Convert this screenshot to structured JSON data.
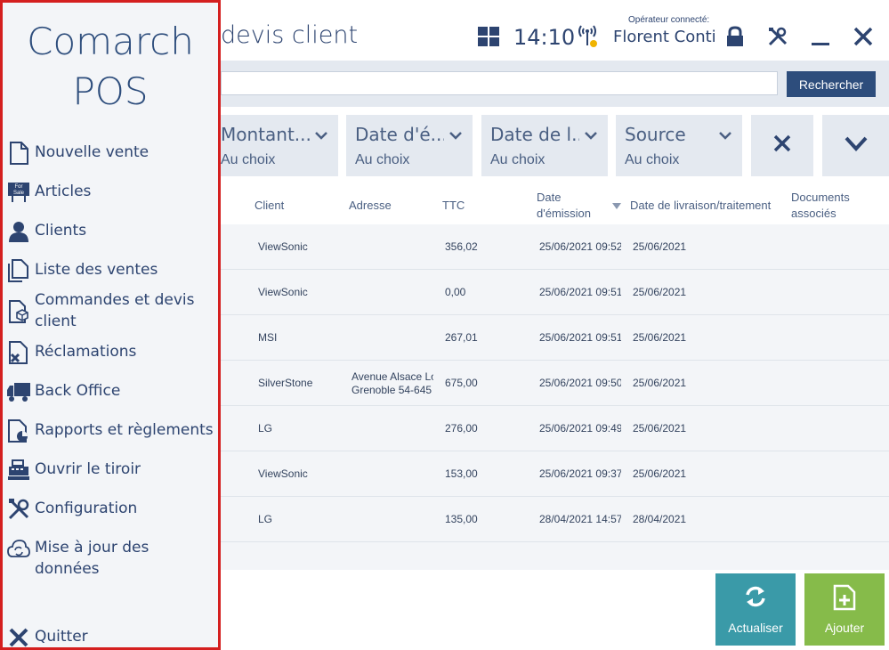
{
  "header": {
    "title": "devis client",
    "time": "14:10",
    "operator_label": "Opérateur connecté:",
    "operator_name": "Florent Conti"
  },
  "search": {
    "value": "",
    "placeholder": "",
    "button_label": "Rechercher"
  },
  "filters": [
    {
      "label": "Montant...",
      "value": "Au choix"
    },
    {
      "label": "Date d'é...",
      "value": "Au choix"
    },
    {
      "label": "Date de l...",
      "value": "Au choix"
    },
    {
      "label": "Source",
      "value": "Au choix"
    }
  ],
  "table": {
    "columns": {
      "client": "Client",
      "adresse": "Adresse",
      "ttc": "TTC",
      "date_emission_1": "Date",
      "date_emission_2": "d'émission",
      "date_livraison": "Date de livraison/traitement",
      "documents_1": "Documents",
      "documents_2": "associés"
    },
    "rows": [
      {
        "client": "ViewSonic",
        "adresse_1": "",
        "adresse_2": "",
        "ttc": "356,02",
        "date_emission": "25/06/2021 09:52",
        "date_livraison": "25/06/2021"
      },
      {
        "client": "ViewSonic",
        "adresse_1": "",
        "adresse_2": "",
        "ttc": "0,00",
        "date_emission": "25/06/2021 09:51",
        "date_livraison": "25/06/2021"
      },
      {
        "client": "MSI",
        "adresse_1": "",
        "adresse_2": "",
        "ttc": "267,01",
        "date_emission": "25/06/2021 09:51",
        "date_livraison": "25/06/2021"
      },
      {
        "client": "SilverStone",
        "adresse_1": "Avenue Alsace Lo",
        "adresse_2": "Grenoble 54-645",
        "ttc": "675,00",
        "date_emission": "25/06/2021 09:50",
        "date_livraison": "25/06/2021"
      },
      {
        "client": "LG",
        "adresse_1": "",
        "adresse_2": "",
        "ttc": "276,00",
        "date_emission": "25/06/2021 09:49",
        "date_livraison": "25/06/2021"
      },
      {
        "client": "ViewSonic",
        "adresse_1": "",
        "adresse_2": "",
        "ttc": "153,00",
        "date_emission": "25/06/2021 09:37",
        "date_livraison": "25/06/2021"
      },
      {
        "client": "LG",
        "adresse_1": "",
        "adresse_2": "",
        "ttc": "135,00",
        "date_emission": "28/04/2021 14:57",
        "date_livraison": "28/04/2021"
      }
    ]
  },
  "actions": {
    "refresh_label": "Actualiser",
    "add_label": "Ajouter"
  },
  "sidebar": {
    "brand_line1": "Comarch",
    "brand_line2": "POS",
    "items": [
      {
        "label": "Nouvelle vente",
        "icon": "document-icon"
      },
      {
        "label": "Articles",
        "icon": "for-sale-icon"
      },
      {
        "label": "Clients",
        "icon": "user-icon"
      },
      {
        "label": "Liste des ventes",
        "icon": "documents-icon"
      },
      {
        "label": "Commandes et devis client",
        "icon": "order-box-icon"
      },
      {
        "label": "Réclamations",
        "icon": "complaint-icon"
      },
      {
        "label": "Back Office",
        "icon": "truck-icon"
      },
      {
        "label": "Rapports et règlements",
        "icon": "report-icon"
      },
      {
        "label": "Ouvrir le tiroir",
        "icon": "cash-register-icon"
      },
      {
        "label": "Configuration",
        "icon": "tools-icon"
      },
      {
        "label": "Mise à jour des données",
        "icon": "sync-cloud-icon"
      }
    ],
    "quit_label": "Quitter"
  },
  "colors": {
    "accent": "#2d4d7c",
    "sidebar_border": "#d41f1f",
    "refresh_button": "#3a9aa8",
    "add_button": "#86bb4a"
  }
}
